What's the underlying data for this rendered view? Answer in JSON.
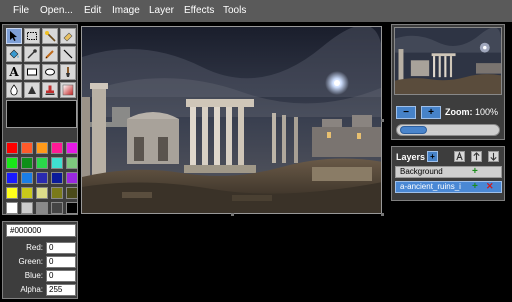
{
  "menubar": {
    "items": [
      "File",
      "Open...",
      "Edit",
      "Image",
      "Layer",
      "Effects",
      "Tools"
    ]
  },
  "tools": [
    {
      "name": "select-tool",
      "icon": "arrow-pointer-icon",
      "active": true
    },
    {
      "name": "rectangle-select-tool",
      "icon": "marquee-icon"
    },
    {
      "name": "magic-wand-tool",
      "icon": "magic-wand-icon"
    },
    {
      "name": "eraser-tool",
      "icon": "eraser-icon"
    },
    {
      "name": "fill-tool",
      "icon": "paint-bucket-icon"
    },
    {
      "name": "eyedropper-tool",
      "icon": "eyedropper-icon"
    },
    {
      "name": "pencil-tool",
      "icon": "pencil-icon"
    },
    {
      "name": "line-tool",
      "icon": "line-icon"
    },
    {
      "name": "text-tool",
      "icon": "text-icon",
      "glyph": "A"
    },
    {
      "name": "rectangle-tool",
      "icon": "rectangle-icon"
    },
    {
      "name": "ellipse-tool",
      "icon": "ellipse-icon"
    },
    {
      "name": "brush-tool",
      "icon": "brush-icon"
    },
    {
      "name": "blur-tool",
      "icon": "water-drop-icon"
    },
    {
      "name": "sharpen-tool",
      "icon": "triangle-icon"
    },
    {
      "name": "clone-stamp-tool",
      "icon": "stamp-icon"
    },
    {
      "name": "gradient-tool",
      "icon": "gradient-icon"
    }
  ],
  "palette": [
    "#ff0000",
    "#ff5a2a",
    "#ff9a1a",
    "#ff1a96",
    "#e61ae6",
    "#19e619",
    "#0f8f19",
    "#2ad84a",
    "#3fe0d0",
    "#7ec87e",
    "#1a1aff",
    "#1a7ee6",
    "#2a2ab0",
    "#0a1a9a",
    "#9a28e0",
    "#ffff1a",
    "#c8c81a",
    "#dcdc8a",
    "#7a7a1a",
    "#4a4a1a",
    "#ffffff",
    "#cccccc",
    "#8a8a8a",
    "#444444",
    "#000000"
  ],
  "color": {
    "hex": "#000000",
    "red_label": "Red:",
    "red": "0",
    "green_label": "Green:",
    "green": "0",
    "blue_label": "Blue:",
    "blue": "0",
    "alpha_label": "Alpha:",
    "alpha": "255"
  },
  "navigator": {
    "zoom_out": "−",
    "zoom_in": "+",
    "zoom_label": "Zoom:",
    "zoom_value": "100%",
    "zoom_slider_fraction": 0.28
  },
  "layers": {
    "title": "Layers",
    "add_symbol": "+",
    "items": [
      {
        "name": "Background",
        "selected": false
      },
      {
        "name": "a-ancient_ruins_i",
        "selected": true
      }
    ]
  },
  "colors": {
    "menubar": "#5a5a5a",
    "panel": "#3d3d3d",
    "accent": "#4682c8",
    "add": "#1a8d1a",
    "delete": "#d21a1a"
  }
}
